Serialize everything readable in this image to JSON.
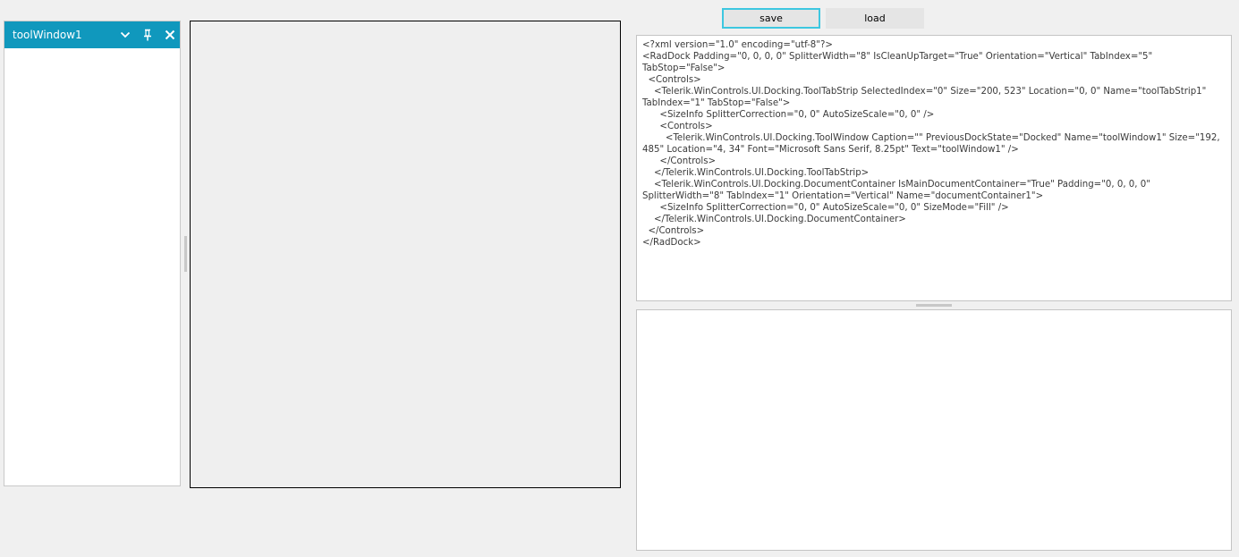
{
  "tool_window": {
    "caption": "toolWindow1",
    "icons": {
      "dropdown": "chevron-down-icon",
      "pin": "pin-icon",
      "close": "close-icon"
    }
  },
  "buttons": {
    "save_label": "save",
    "load_label": "load"
  },
  "xml_output": {
    "lines": [
      "<?xml version=\"1.0\" encoding=\"utf-8\"?>",
      "<RadDock Padding=\"0, 0, 0, 0\" SplitterWidth=\"8\" IsCleanUpTarget=\"True\" Orientation=\"Vertical\" TabIndex=\"5\"",
      "TabStop=\"False\">",
      "  <Controls>",
      "    <Telerik.WinControls.UI.Docking.ToolTabStrip SelectedIndex=\"0\" Size=\"200, 523\" Location=\"0, 0\" Name=\"toolTabStrip1\"",
      "TabIndex=\"1\" TabStop=\"False\">",
      "      <SizeInfo SplitterCorrection=\"0, 0\" AutoSizeScale=\"0, 0\" />",
      "      <Controls>",
      "        <Telerik.WinControls.UI.Docking.ToolWindow Caption=\"\" PreviousDockState=\"Docked\" Name=\"toolWindow1\" Size=\"192,",
      "485\" Location=\"4, 34\" Font=\"Microsoft Sans Serif, 8.25pt\" Text=\"toolWindow1\" />",
      "      </Controls>",
      "    </Telerik.WinControls.UI.Docking.ToolTabStrip>",
      "    <Telerik.WinControls.UI.Docking.DocumentContainer IsMainDocumentContainer=\"True\" Padding=\"0, 0, 0, 0\"",
      "SplitterWidth=\"8\" TabIndex=\"1\" Orientation=\"Vertical\" Name=\"documentContainer1\">",
      "      <SizeInfo SplitterCorrection=\"0, 0\" AutoSizeScale=\"0, 0\" SizeMode=\"Fill\" />",
      "    </Telerik.WinControls.UI.Docking.DocumentContainer>",
      "  </Controls>",
      "</RadDock>"
    ]
  },
  "colors": {
    "title_bar": "#1098bd",
    "save_focus_border": "#3dc7e0",
    "background": "#f0f0f0"
  }
}
